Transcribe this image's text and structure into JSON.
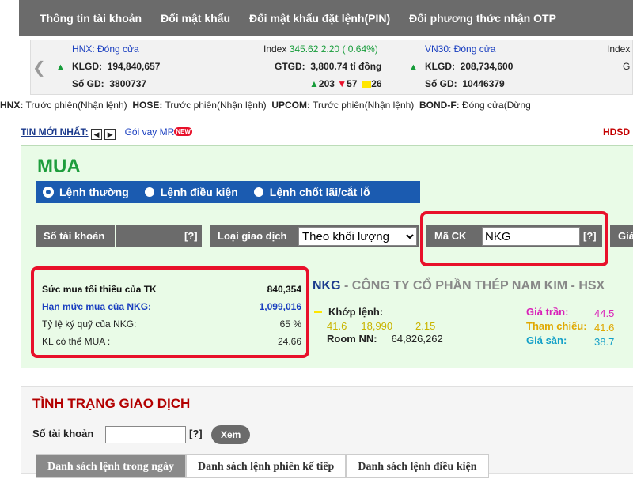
{
  "topnav": [
    "Thông tin tài khoản",
    "Đổi mật khẩu",
    "Đổi mật khẩu đặt lệnh(PIN)",
    "Đổi phương thức nhận OTP"
  ],
  "ticker": {
    "hnx": {
      "status": "HNX: Đóng cửa",
      "klgd_label": "KLGD:",
      "klgd": "194,840,657",
      "sogd_label": "Số GD:",
      "sogd": "3800737",
      "index_label": "Index",
      "index": "345.62",
      "change": "2.20 ( 0.64%)",
      "gtgd_label": "GTGD:",
      "gtgd": "3,800.74 tỉ đồng",
      "up": "203",
      "down": "57",
      "flat": "26"
    },
    "vn30": {
      "status": "VN30: Đóng cửa",
      "klgd_label": "KLGD:",
      "klgd": "208,734,600",
      "sogd_label": "Số GD:",
      "sogd": "10446379",
      "index_label": "Index",
      "gtgd_label": "G"
    }
  },
  "sessions": [
    {
      "market": "HNX:",
      "status": "Trước phiên(Nhận lệnh)"
    },
    {
      "market": "HOSE:",
      "status": "Trước phiên(Nhận lệnh)"
    },
    {
      "market": "UPCOM:",
      "status": "Trước phiên(Nhận lệnh)"
    },
    {
      "market": "BOND-F:",
      "status": "Đóng cửa(Dừng"
    }
  ],
  "news": {
    "label": "TIN MỚI NHẤT:",
    "prev": "◀",
    "next": "▶",
    "loan": "Gói vay MR",
    "new_badge": "NEW",
    "hdsd": "HDSD"
  },
  "buy": {
    "title": "MUA",
    "order_types": [
      "Lệnh thường",
      "Lệnh điều kiện",
      "Lệnh chốt lãi/cắt lỗ"
    ],
    "account_label": "Số tài khoản",
    "help": "[?]",
    "trade_type_label": "Loại giao dịch",
    "trade_type_value": "Theo khối lượng",
    "symbol_label": "Mã CK",
    "symbol_value": "NKG",
    "price_label_cut": "Giá",
    "power": [
      {
        "label": "Sức mua tối thiểu của TK",
        "value": "840,354"
      },
      {
        "label": "Hạn mức mua của NKG:",
        "value": "1,099,016"
      },
      {
        "label": "Tỷ lệ ký quỹ của NKG:",
        "value": "65 %"
      },
      {
        "label": "KL có thể MUA :",
        "value": "24.66"
      }
    ],
    "stock": {
      "code": "NKG",
      "name": " - CÔNG TY CỔ PHẦN THÉP NAM KIM - HSX",
      "match_label": "Khớp lệnh:",
      "match_price": "41.6",
      "match_volume": "18,990",
      "match_change": "2.15",
      "room_label": "Room NN:",
      "room_value": "64,826,262",
      "ceiling_label": "Giá trần:",
      "ceiling": "44.5",
      "ref_label": "Tham chiếu:",
      "ref": "41.6",
      "floor_label": "Giá sàn:",
      "floor": "38.7"
    }
  },
  "status": {
    "title": "TÌNH TRẠNG GIAO DỊCH",
    "account_label": "Số tài khoản",
    "help": "[?]",
    "view_button": "Xem",
    "tabs": [
      "Danh sách lệnh trong ngày",
      "Danh sách lệnh phiên kế tiếp",
      "Danh sách lệnh điều kiện"
    ]
  }
}
